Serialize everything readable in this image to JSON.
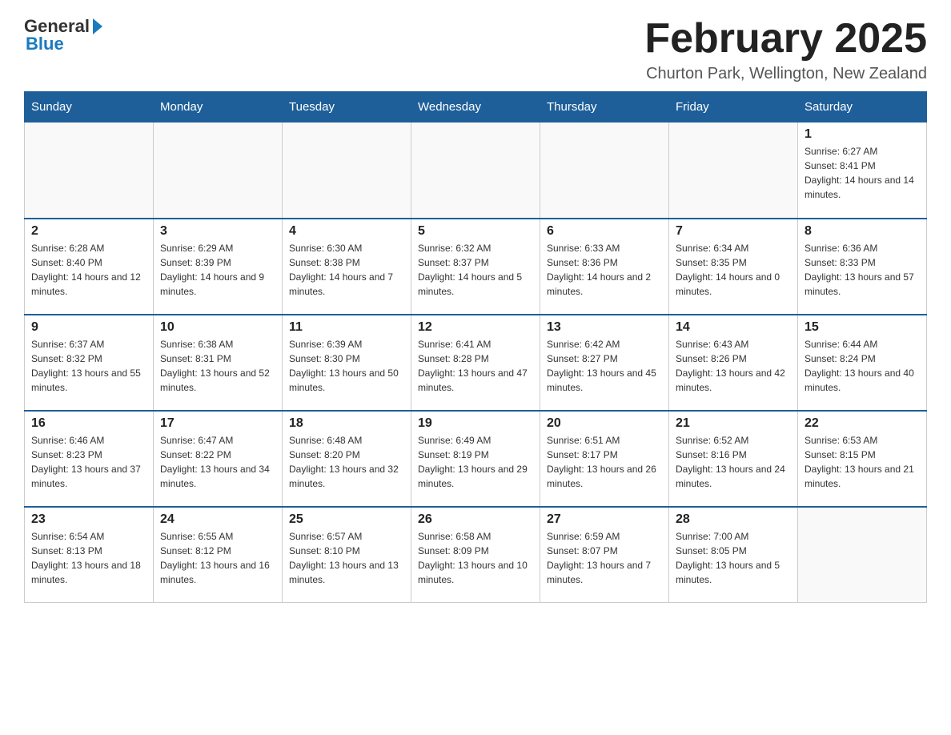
{
  "header": {
    "logo_general": "General",
    "logo_blue": "Blue",
    "title": "February 2025",
    "location": "Churton Park, Wellington, New Zealand"
  },
  "weekdays": [
    "Sunday",
    "Monday",
    "Tuesday",
    "Wednesday",
    "Thursday",
    "Friday",
    "Saturday"
  ],
  "weeks": [
    [
      {
        "day": "",
        "info": ""
      },
      {
        "day": "",
        "info": ""
      },
      {
        "day": "",
        "info": ""
      },
      {
        "day": "",
        "info": ""
      },
      {
        "day": "",
        "info": ""
      },
      {
        "day": "",
        "info": ""
      },
      {
        "day": "1",
        "info": "Sunrise: 6:27 AM\nSunset: 8:41 PM\nDaylight: 14 hours and 14 minutes."
      }
    ],
    [
      {
        "day": "2",
        "info": "Sunrise: 6:28 AM\nSunset: 8:40 PM\nDaylight: 14 hours and 12 minutes."
      },
      {
        "day": "3",
        "info": "Sunrise: 6:29 AM\nSunset: 8:39 PM\nDaylight: 14 hours and 9 minutes."
      },
      {
        "day": "4",
        "info": "Sunrise: 6:30 AM\nSunset: 8:38 PM\nDaylight: 14 hours and 7 minutes."
      },
      {
        "day": "5",
        "info": "Sunrise: 6:32 AM\nSunset: 8:37 PM\nDaylight: 14 hours and 5 minutes."
      },
      {
        "day": "6",
        "info": "Sunrise: 6:33 AM\nSunset: 8:36 PM\nDaylight: 14 hours and 2 minutes."
      },
      {
        "day": "7",
        "info": "Sunrise: 6:34 AM\nSunset: 8:35 PM\nDaylight: 14 hours and 0 minutes."
      },
      {
        "day": "8",
        "info": "Sunrise: 6:36 AM\nSunset: 8:33 PM\nDaylight: 13 hours and 57 minutes."
      }
    ],
    [
      {
        "day": "9",
        "info": "Sunrise: 6:37 AM\nSunset: 8:32 PM\nDaylight: 13 hours and 55 minutes."
      },
      {
        "day": "10",
        "info": "Sunrise: 6:38 AM\nSunset: 8:31 PM\nDaylight: 13 hours and 52 minutes."
      },
      {
        "day": "11",
        "info": "Sunrise: 6:39 AM\nSunset: 8:30 PM\nDaylight: 13 hours and 50 minutes."
      },
      {
        "day": "12",
        "info": "Sunrise: 6:41 AM\nSunset: 8:28 PM\nDaylight: 13 hours and 47 minutes."
      },
      {
        "day": "13",
        "info": "Sunrise: 6:42 AM\nSunset: 8:27 PM\nDaylight: 13 hours and 45 minutes."
      },
      {
        "day": "14",
        "info": "Sunrise: 6:43 AM\nSunset: 8:26 PM\nDaylight: 13 hours and 42 minutes."
      },
      {
        "day": "15",
        "info": "Sunrise: 6:44 AM\nSunset: 8:24 PM\nDaylight: 13 hours and 40 minutes."
      }
    ],
    [
      {
        "day": "16",
        "info": "Sunrise: 6:46 AM\nSunset: 8:23 PM\nDaylight: 13 hours and 37 minutes."
      },
      {
        "day": "17",
        "info": "Sunrise: 6:47 AM\nSunset: 8:22 PM\nDaylight: 13 hours and 34 minutes."
      },
      {
        "day": "18",
        "info": "Sunrise: 6:48 AM\nSunset: 8:20 PM\nDaylight: 13 hours and 32 minutes."
      },
      {
        "day": "19",
        "info": "Sunrise: 6:49 AM\nSunset: 8:19 PM\nDaylight: 13 hours and 29 minutes."
      },
      {
        "day": "20",
        "info": "Sunrise: 6:51 AM\nSunset: 8:17 PM\nDaylight: 13 hours and 26 minutes."
      },
      {
        "day": "21",
        "info": "Sunrise: 6:52 AM\nSunset: 8:16 PM\nDaylight: 13 hours and 24 minutes."
      },
      {
        "day": "22",
        "info": "Sunrise: 6:53 AM\nSunset: 8:15 PM\nDaylight: 13 hours and 21 minutes."
      }
    ],
    [
      {
        "day": "23",
        "info": "Sunrise: 6:54 AM\nSunset: 8:13 PM\nDaylight: 13 hours and 18 minutes."
      },
      {
        "day": "24",
        "info": "Sunrise: 6:55 AM\nSunset: 8:12 PM\nDaylight: 13 hours and 16 minutes."
      },
      {
        "day": "25",
        "info": "Sunrise: 6:57 AM\nSunset: 8:10 PM\nDaylight: 13 hours and 13 minutes."
      },
      {
        "day": "26",
        "info": "Sunrise: 6:58 AM\nSunset: 8:09 PM\nDaylight: 13 hours and 10 minutes."
      },
      {
        "day": "27",
        "info": "Sunrise: 6:59 AM\nSunset: 8:07 PM\nDaylight: 13 hours and 7 minutes."
      },
      {
        "day": "28",
        "info": "Sunrise: 7:00 AM\nSunset: 8:05 PM\nDaylight: 13 hours and 5 minutes."
      },
      {
        "day": "",
        "info": ""
      }
    ]
  ]
}
